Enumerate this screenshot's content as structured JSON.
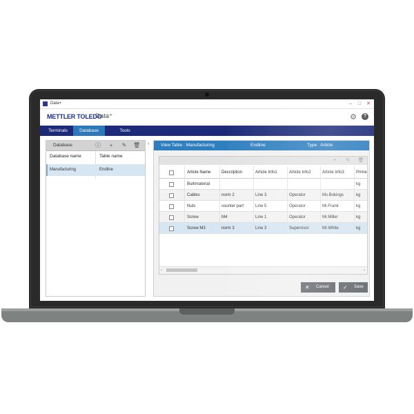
{
  "window": {
    "title": "Data+",
    "minimize": "–",
    "maximize": "□",
    "close": "✕"
  },
  "brand": {
    "logo": "METTLER TOLEDO",
    "app_name": "Data⁺"
  },
  "nav": {
    "tabs": [
      {
        "label": "Terminals"
      },
      {
        "label": "Database"
      },
      {
        "label": "Tools"
      }
    ],
    "active": "Database"
  },
  "left_panel": {
    "title": "Database",
    "columns": [
      "Database name",
      "Table name"
    ],
    "rows": [
      {
        "database": "Manufacturing",
        "table": "Endline"
      }
    ]
  },
  "right_panel": {
    "view_table": "View Table : Manufacturing",
    "table_name": "Endline",
    "type": "Type : Article",
    "columns": [
      "Article Name",
      "Description",
      "Article Info1",
      "Article Info2",
      "Article Info3",
      "Prime"
    ],
    "rows": [
      [
        "Bulkmaterial",
        "",
        "",
        "",
        "",
        "kg"
      ],
      [
        "Cables",
        "norm 2",
        "Line 3",
        "Operator",
        "Ms.Bokings",
        "kg"
      ],
      [
        "Nuts",
        "counter part",
        "Line 5",
        "Operator",
        "Mr.Frank",
        "kg"
      ],
      [
        "Screw",
        "M4",
        "Line 1",
        "Operator",
        "Mr.Miller",
        "kg"
      ],
      [
        "Screw M3",
        "norm 3",
        "Line 3",
        "Supervisor",
        "Mr.White",
        "kg"
      ]
    ],
    "selected_row": 4
  },
  "buttons": {
    "cancel": "Cancel",
    "save": "Save"
  },
  "icons": {
    "gear": "gear-icon",
    "help": "help-icon",
    "info": "info-icon",
    "add": "add-icon",
    "edit": "edit-icon",
    "delete": "delete-icon"
  },
  "colors": {
    "nav_bg": "#1c2a79",
    "nav_active": "#2c78b8",
    "header_blue": "#2f7fc0",
    "selected_row": "#d6e6f2",
    "button_bg": "#666b70",
    "logo": "#1a2e8f"
  }
}
